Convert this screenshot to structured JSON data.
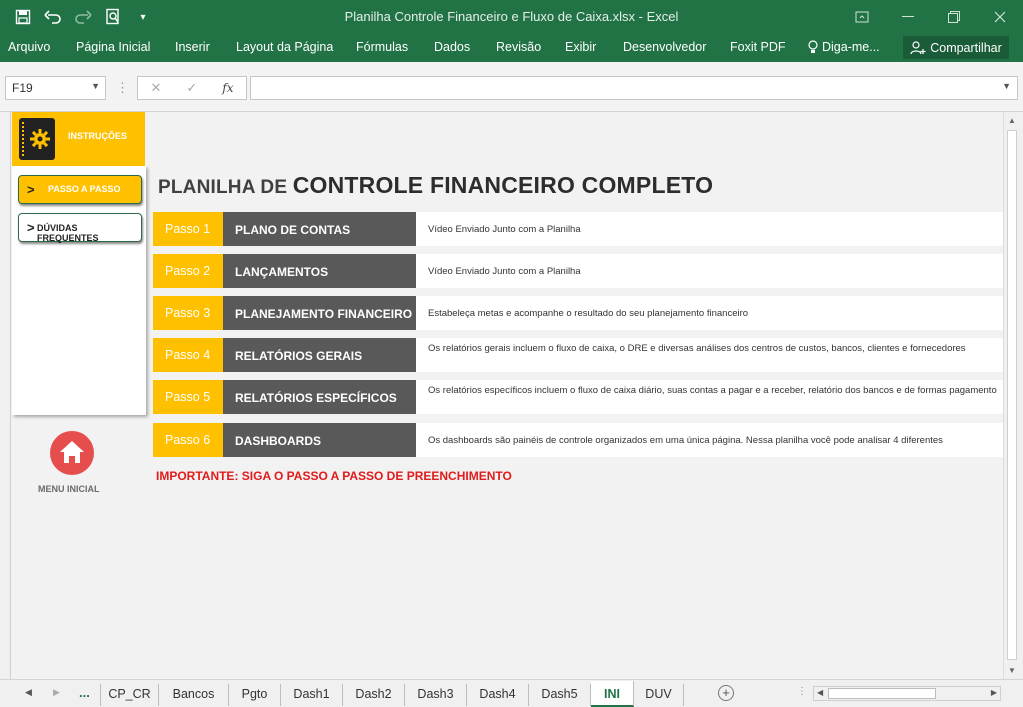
{
  "window": {
    "title": "Planilha Controle Financeiro e Fluxo de Caixa.xlsx - Excel"
  },
  "qat": {
    "icons": [
      "save-icon",
      "undo-icon",
      "redo-icon",
      "print-preview-icon",
      "customize-icon"
    ]
  },
  "ribbon": {
    "tabs": [
      "Arquivo",
      "Página Inicial",
      "Inserir",
      "Layout da Página",
      "Fórmulas",
      "Dados",
      "Revisão",
      "Exibir",
      "Desenvolvedor",
      "Foxit PDF"
    ],
    "tell_me": "Diga-me...",
    "share": "Compartilhar"
  },
  "formula_bar": {
    "name_box": "F19",
    "fx_label": "fx",
    "formula": ""
  },
  "left_panel": {
    "instructions_label": "INSTRUÇÕES",
    "passo_button": "PASSO A PASSO",
    "duvidas_button": "DÚVIDAS FREQUENTES",
    "chevron": ">",
    "home_label": "MENU INICIAL"
  },
  "main": {
    "title_prefix": "PLANILHA DE ",
    "title_main": "CONTROLE FINANCEIRO COMPLETO",
    "steps": [
      {
        "num": "Passo 1",
        "name": "PLANO DE CONTAS",
        "desc": "Vídeo Enviado Junto com a Planilha"
      },
      {
        "num": "Passo 2",
        "name": "LANÇAMENTOS",
        "desc": "Vídeo Enviado Junto com a Planilha"
      },
      {
        "num": "Passo 3",
        "name": "PLANEJAMENTO FINANCEIRO",
        "desc": "Estabeleça metas e acompanhe o resultado do seu planejamento financeiro"
      },
      {
        "num": "Passo 4",
        "name": "RELATÓRIOS GERAIS",
        "desc": "Os relatórios gerais incluem o fluxo de caixa, o DRE e diversas análises dos centros de custos, bancos, clientes e fornecedores"
      },
      {
        "num": "Passo 5",
        "name": "RELATÓRIOS ESPECÍFICOS",
        "desc": "Os relatórios específicos incluem o fluxo de caixa diário, suas contas a pagar e a receber, relatório dos bancos e de formas pagamento"
      },
      {
        "num": "Passo 6",
        "name": "DASHBOARDS",
        "desc": "Os dashboards são painéis de controle organizados em uma única página. Nessa planilha você pode analisar 4 diferentes"
      }
    ],
    "important": "IMPORTANTE: SIGA O PASSO A PASSO DE PREENCHIMENTO"
  },
  "sheet_tabs": {
    "ellipsis": "...",
    "tabs": [
      "CP_CR",
      "Bancos",
      "Pgto",
      "Dash1",
      "Dash2",
      "Dash3",
      "Dash4",
      "Dash5",
      "INI",
      "DUV"
    ],
    "active": "INI",
    "add_label": "+"
  },
  "colors": {
    "excel_green": "#217346",
    "accent_yellow": "#ffc000",
    "dark_gray": "#595959",
    "important_red": "#e01b1b",
    "home_red": "#e64e4e"
  }
}
